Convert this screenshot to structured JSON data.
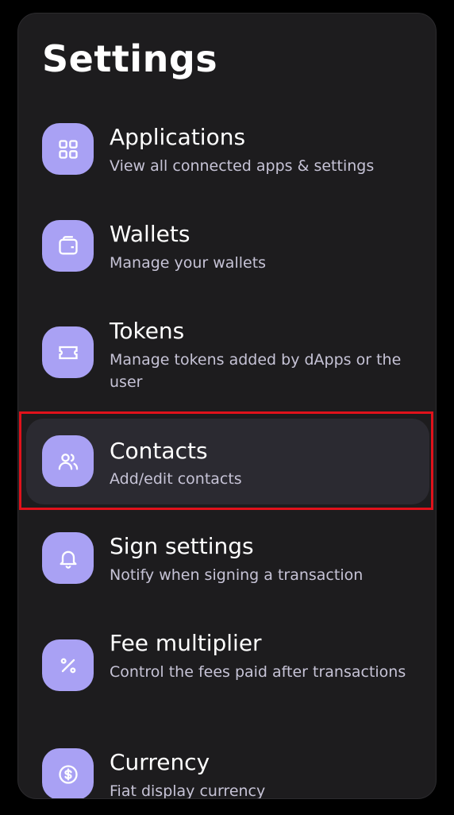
{
  "page": {
    "title": "Settings"
  },
  "items": [
    {
      "title": "Applications",
      "subtitle": "View all connected apps & settings",
      "icon": "grid-icon"
    },
    {
      "title": "Wallets",
      "subtitle": "Manage your wallets",
      "icon": "wallet-icon"
    },
    {
      "title": "Tokens",
      "subtitle": "Manage tokens added by dApps or the user",
      "icon": "ticket-icon"
    },
    {
      "title": "Contacts",
      "subtitle": "Add/edit contacts",
      "icon": "users-icon",
      "active": true
    },
    {
      "title": "Sign settings",
      "subtitle": "Notify when signing a transaction",
      "icon": "bell-icon"
    },
    {
      "title": "Fee multiplier",
      "subtitle": "Control the fees paid after transactions",
      "icon": "percent-icon"
    },
    {
      "title": "Currency",
      "subtitle": "Fiat display currency",
      "icon": "dollar-coin-icon"
    }
  ],
  "colors": {
    "background": "#000000",
    "panel": "#1d1c1e",
    "accent": "#a9a1f4",
    "active_row": "#2b2a31",
    "highlight_border": "#e0121b"
  }
}
